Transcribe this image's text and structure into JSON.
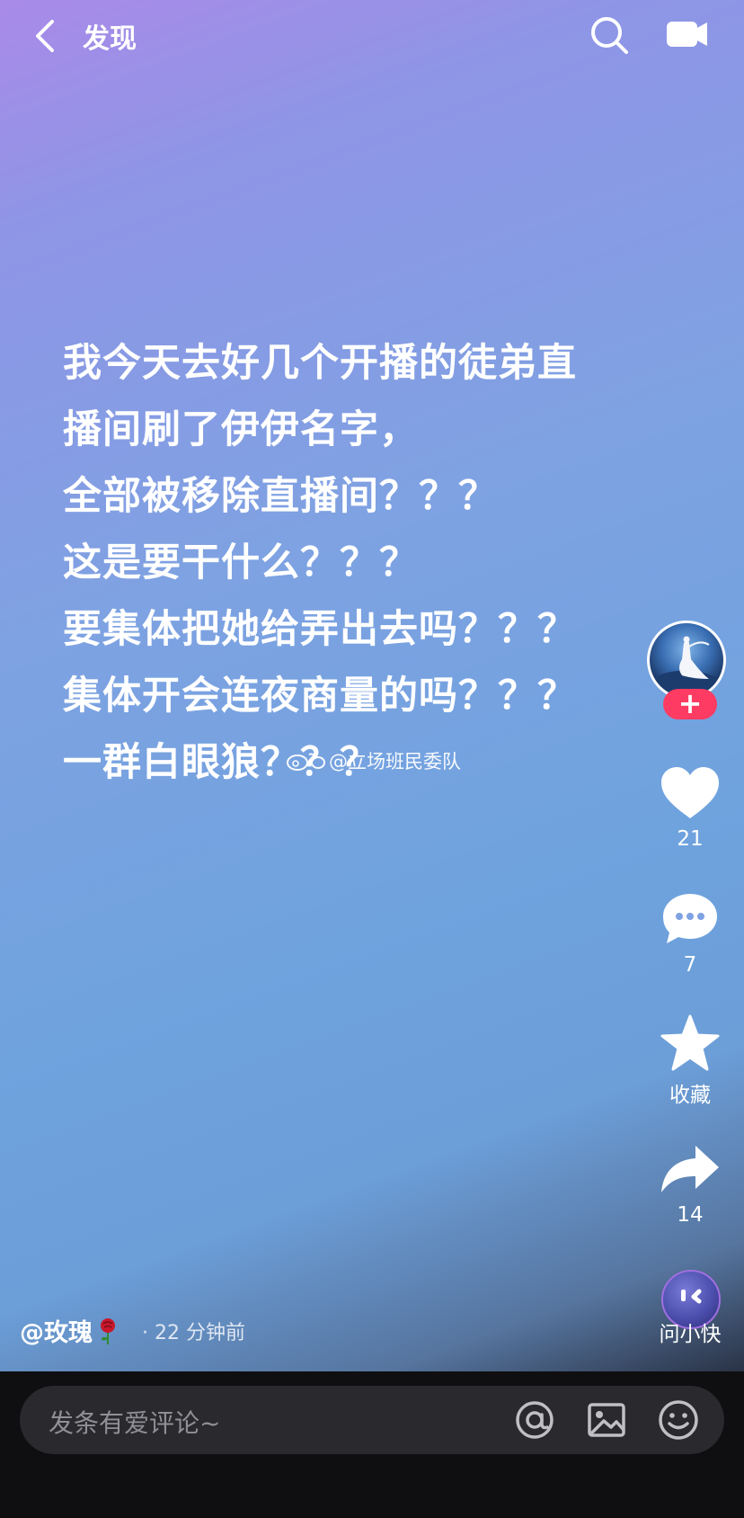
{
  "header": {
    "title": "发现"
  },
  "post": {
    "lines": [
      "我今天去好几个开播的徒弟直",
      "播间刷了伊伊名字，",
      "全部被移除直播间？？？",
      "这是要干什么？？？",
      "要集体把她给弄出去吗？？？",
      "集体开会连夜商量的吗？？？",
      "一群白眼狼？？？"
    ],
    "watermark": "@立场班民委队"
  },
  "rail": {
    "follow_symbol": "+",
    "likes": "21",
    "comments": "7",
    "favorite_label": "收藏",
    "shares": "14",
    "ask_label": "问小快"
  },
  "author": {
    "name": "@玫瑰",
    "time": "· 22 分钟前"
  },
  "comment_bar": {
    "placeholder": "发条有爱评论~"
  },
  "colors": {
    "follow": "#fe3b62",
    "accent_top": "#a98ae8",
    "bottom_bar": "#0f0f11"
  }
}
